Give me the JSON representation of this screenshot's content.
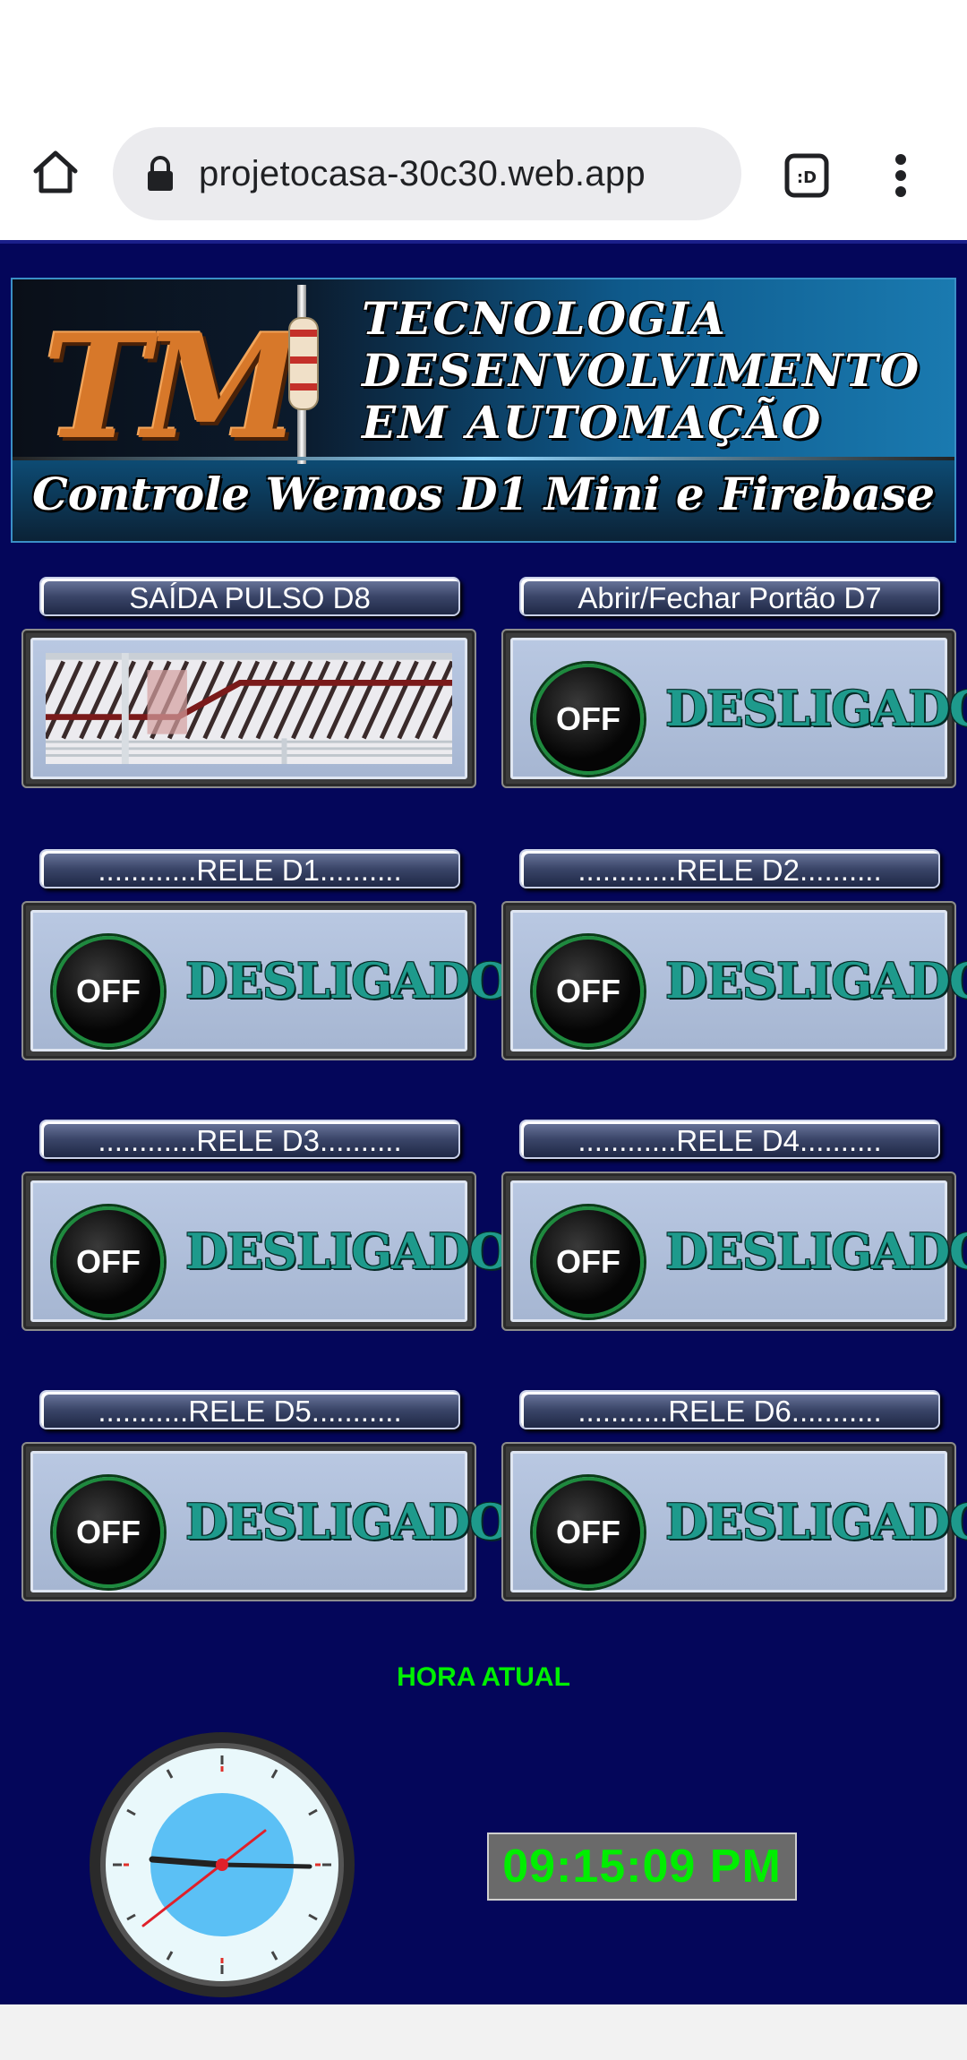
{
  "browser": {
    "url": "projetocasa-30c30.web.app",
    "tabs_badge": ":D"
  },
  "banner": {
    "logo": "TM",
    "line1": "TECNOLOGIA",
    "line2": "DESENVOLVIMENTO",
    "line3": "EM AUTOMAÇÃO",
    "subtitle": "Controle Wemos D1 Mini e Firebase"
  },
  "controls": [
    {
      "label": "SAÍDA PULSO D8",
      "type": "gate"
    },
    {
      "label": "Abrir/Fechar Portão D7",
      "button": "OFF",
      "state": "DESLIGADO"
    },
    {
      "label": "............RELE D1..........",
      "button": "OFF",
      "state": "DESLIGADO"
    },
    {
      "label": "............RELE D2..........",
      "button": "OFF",
      "state": "DESLIGADO"
    },
    {
      "label": "............RELE D3..........",
      "button": "OFF",
      "state": "DESLIGADO"
    },
    {
      "label": "............RELE D4..........",
      "button": "OFF",
      "state": "DESLIGADO"
    },
    {
      "label": "...........RELE D5...........",
      "button": "OFF",
      "state": "DESLIGADO"
    },
    {
      "label": "...........RELE D6...........",
      "button": "OFF",
      "state": "DESLIGADO"
    }
  ],
  "time": {
    "title": "HORA ATUAL",
    "digital": "09:15:09 PM"
  },
  "colors": {
    "page_bg": "#04065a",
    "state_text": "#1e9a8c",
    "digital_text": "#00ee00",
    "hora_title": "#00f000"
  }
}
